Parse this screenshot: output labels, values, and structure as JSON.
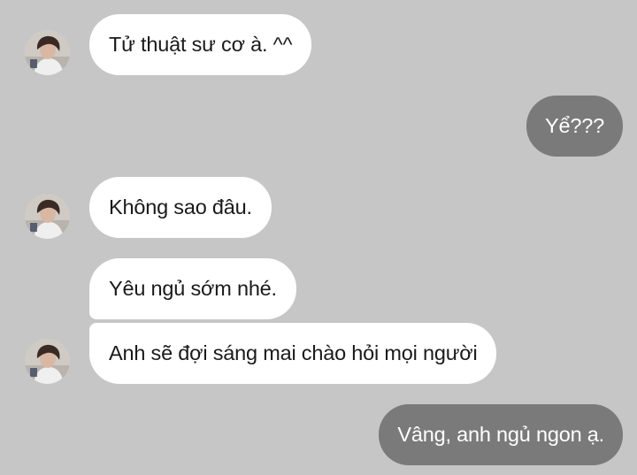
{
  "messages": [
    {
      "id": "m1",
      "side": "incoming",
      "text": "Tử thuật sư cơ à. ^^"
    },
    {
      "id": "m2",
      "side": "outgoing",
      "text": "Yể???"
    },
    {
      "id": "m3",
      "side": "incoming",
      "text": "Không sao đâu."
    },
    {
      "id": "m4",
      "side": "incoming",
      "text": "Yêu ngủ sớm nhé."
    },
    {
      "id": "m5",
      "side": "incoming",
      "text": "Anh sẽ đợi sáng mai chào hỏi mọi người"
    },
    {
      "id": "m6",
      "side": "outgoing",
      "text": "Vâng, anh ngủ ngon ạ."
    }
  ],
  "colors": {
    "background": "#c6c6c6",
    "incoming_bubble": "#ffffff",
    "outgoing_bubble": "#7a7a7a",
    "incoming_text": "#1a1a1a",
    "outgoing_text": "#ffffff"
  },
  "icons": {
    "avatar": "contact-avatar-photo"
  }
}
